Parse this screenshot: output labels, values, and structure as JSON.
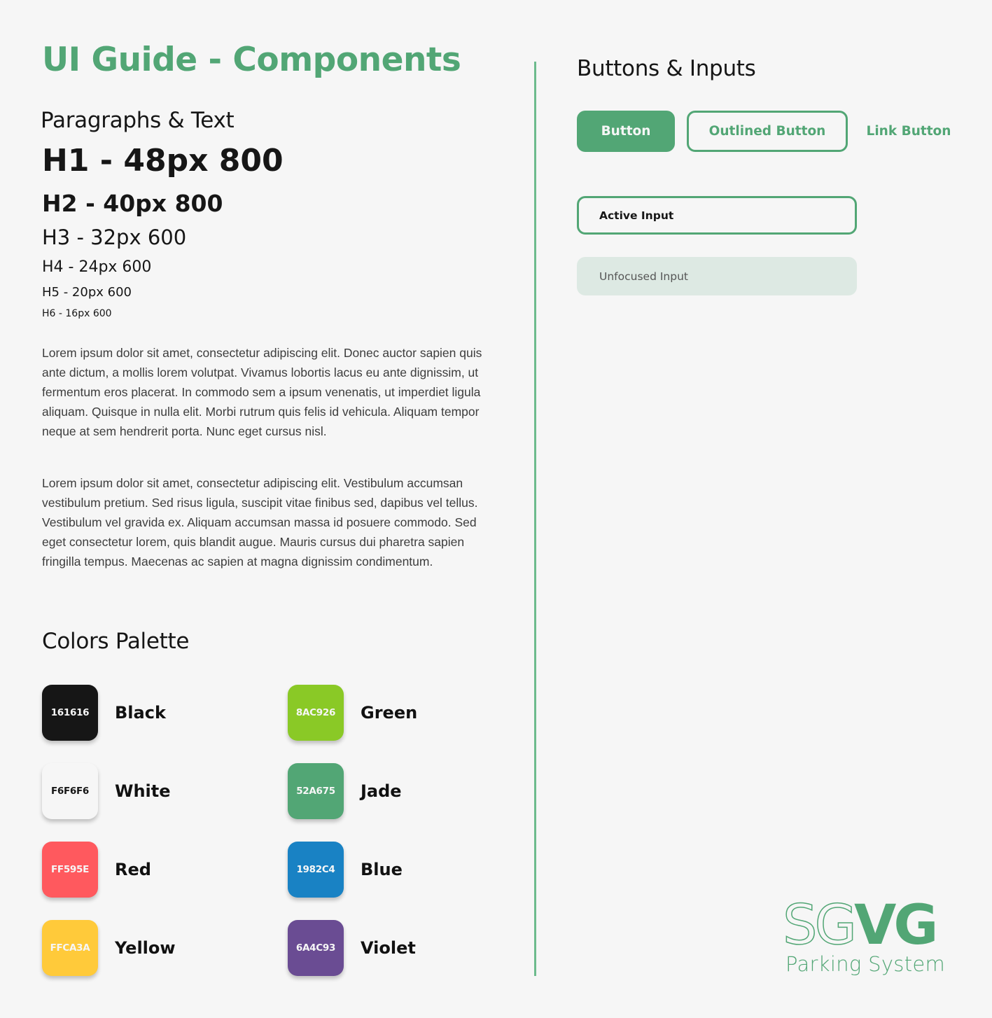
{
  "page": {
    "title": "UI Guide - Components"
  },
  "paragraphs_section": {
    "title": "Paragraphs & Text",
    "headings": [
      {
        "level": "h1",
        "label": "H1 - 48px 800"
      },
      {
        "level": "h2",
        "label": "H2 - 40px 800"
      },
      {
        "level": "h3",
        "label": "H3 - 32px 600"
      },
      {
        "level": "h4",
        "label": "H4 - 24px 600"
      },
      {
        "level": "h5",
        "label": "H5 - 20px 600"
      },
      {
        "level": "h6",
        "label": "H6 - 16px 600"
      }
    ],
    "paragraphs": [
      "Lorem ipsum dolor sit amet, consectetur adipiscing elit. Donec auctor sapien quis ante dictum, a mollis lorem volutpat. Vivamus lobortis lacus eu ante dignissim, ut fermentum eros placerat. In commodo sem a ipsum venenatis, ut imperdiet ligula aliquam. Quisque in nulla elit. Morbi rutrum quis felis id vehicula. Aliquam tempor neque at sem hendrerit porta. Nunc eget cursus nisl.",
      "Lorem ipsum dolor sit amet, consectetur adipiscing elit. Vestibulum accumsan vestibulum pretium. Sed risus ligula, suscipit vitae finibus sed, dapibus vel tellus. Vestibulum vel gravida ex. Aliquam accumsan massa id posuere commodo. Sed eget consectetur lorem, quis blandit augue. Mauris cursus dui pharetra sapien fringilla tempus. Maecenas ac sapien at magna dignissim condimentum."
    ]
  },
  "colors_section": {
    "title": "Colors Palette",
    "colors": [
      {
        "name": "Black",
        "hex_label": "161616",
        "hex": "#161616"
      },
      {
        "name": "White",
        "hex_label": "F6F6F6",
        "hex": "#F6F6F6"
      },
      {
        "name": "Red",
        "hex_label": "FF595E",
        "hex": "#FF595E"
      },
      {
        "name": "Yellow",
        "hex_label": "FFCA3A",
        "hex": "#FFCA3A"
      },
      {
        "name": "Green",
        "hex_label": "8AC926",
        "hex": "#8AC926"
      },
      {
        "name": "Jade",
        "hex_label": "52A675",
        "hex": "#52A675"
      },
      {
        "name": "Blue",
        "hex_label": "1982C4",
        "hex": "#1982C4"
      },
      {
        "name": "Violet",
        "hex_label": "6A4C93",
        "hex": "#6A4C93"
      }
    ]
  },
  "buttons_section": {
    "title": "Buttons & Inputs",
    "primary_button": "Button",
    "outlined_button": "Outlined Button",
    "link_button": "Link Button",
    "active_input_value": "Active Input",
    "unfocused_input_placeholder": "Unfocused Input"
  },
  "logo": {
    "outline_text": "SG",
    "solid_text": "VG",
    "subtitle": "Parking System"
  },
  "theme": {
    "accent": "#52A675",
    "background": "#F6F6F6",
    "unfocused_input_bg": "#DDE9E3"
  }
}
